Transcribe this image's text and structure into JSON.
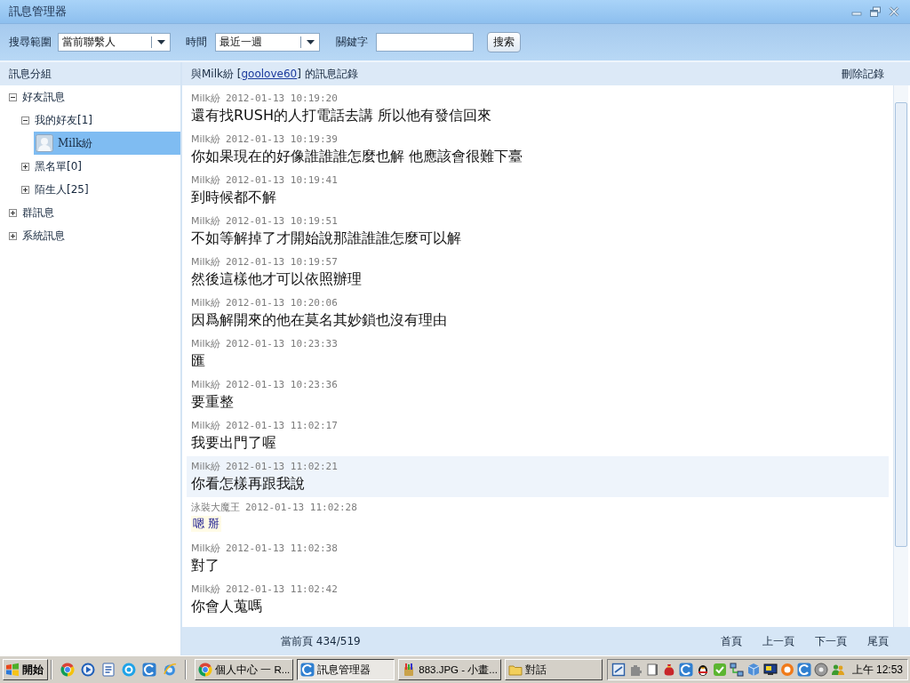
{
  "window": {
    "title": "訊息管理器"
  },
  "toolbar": {
    "scope_label": "搜尋範圍",
    "scope_value": "當前聯繫人",
    "time_label": "時間",
    "time_value": "最近一週",
    "keyword_label": "關鍵字",
    "search_button": "搜索"
  },
  "sidebar": {
    "title": "訊息分組",
    "tree": [
      {
        "label": "好友訊息",
        "kind": "group",
        "expanded": true,
        "selected": false,
        "children": [
          {
            "label": "我的好友[1]",
            "kind": "group",
            "expanded": true,
            "selected": false,
            "children": [
              {
                "label": "Milk紛",
                "kind": "contact",
                "selected": true
              }
            ]
          },
          {
            "label": "黑名單[0]",
            "kind": "group",
            "expanded": false,
            "selected": false
          },
          {
            "label": "陌生人[25]",
            "kind": "group",
            "expanded": false,
            "selected": false
          }
        ]
      },
      {
        "label": "群訊息",
        "kind": "group",
        "expanded": false,
        "selected": false
      },
      {
        "label": "系統訊息",
        "kind": "group",
        "expanded": false,
        "selected": false
      }
    ]
  },
  "history": {
    "title_prefix": "與Milk紛 [",
    "title_link": "goolove60",
    "title_suffix": "] 的訊息記錄",
    "delete_button": "刪除記錄",
    "messages": [
      {
        "sender": "Milk紛",
        "time": "2012-01-13 10:19:20",
        "text": "還有找RUSH的人打電話去講 所以他有發信回來",
        "kind": "received",
        "highlighted": false
      },
      {
        "sender": "Milk紛",
        "time": "2012-01-13 10:19:39",
        "text": "你如果現在的好像誰誰誰怎麼也解 他應該會很難下臺",
        "kind": "received",
        "highlighted": false
      },
      {
        "sender": "Milk紛",
        "time": "2012-01-13 10:19:41",
        "text": "到時候都不解",
        "kind": "received",
        "highlighted": false
      },
      {
        "sender": "Milk紛",
        "time": "2012-01-13 10:19:51",
        "text": "不如等解掉了才開始說那誰誰誰怎麼可以解",
        "kind": "received",
        "highlighted": false
      },
      {
        "sender": "Milk紛",
        "time": "2012-01-13 10:19:57",
        "text": "然後這樣他才可以依照辦理",
        "kind": "received",
        "highlighted": false
      },
      {
        "sender": "Milk紛",
        "time": "2012-01-13 10:20:06",
        "text": "因爲解開來的他在莫名其妙鎖也沒有理由",
        "kind": "received",
        "highlighted": false
      },
      {
        "sender": "Milk紛",
        "time": "2012-01-13 10:23:33",
        "text": "匯",
        "kind": "received",
        "highlighted": false
      },
      {
        "sender": "Milk紛",
        "time": "2012-01-13 10:23:36",
        "text": "要重整",
        "kind": "received",
        "highlighted": false
      },
      {
        "sender": "Milk紛",
        "time": "2012-01-13 11:02:17",
        "text": "我要出門了喔",
        "kind": "received",
        "highlighted": false
      },
      {
        "sender": "Milk紛",
        "time": "2012-01-13 11:02:21",
        "text": "你看怎樣再跟我說",
        "kind": "received",
        "highlighted": true
      },
      {
        "sender": "泳裝大魔王",
        "time": "2012-01-13 11:02:28",
        "text": "嗯 掰",
        "kind": "sent",
        "highlighted": false
      },
      {
        "sender": "Milk紛",
        "time": "2012-01-13 11:02:38",
        "text": "對了",
        "kind": "received",
        "highlighted": false
      },
      {
        "sender": "Milk紛",
        "time": "2012-01-13 11:02:42",
        "text": "你會人蒐嗎",
        "kind": "received",
        "highlighted": false
      }
    ]
  },
  "pager": {
    "current_page": "當前頁 434/519",
    "buttons": [
      "首頁",
      "上一頁",
      "下一頁",
      "尾頁"
    ]
  },
  "taskbar": {
    "start_button": "開始",
    "tasks": [
      {
        "label": "個人中心 一 R...",
        "kind": "browser",
        "selected": false
      },
      {
        "label": "訊息管理器",
        "kind": "messenger",
        "selected": true
      },
      {
        "label": "883.JPG - 小畫...",
        "kind": "paint",
        "selected": false
      },
      {
        "label": "對話",
        "kind": "folder",
        "selected": false
      }
    ],
    "clock": "上午 12:53"
  }
}
